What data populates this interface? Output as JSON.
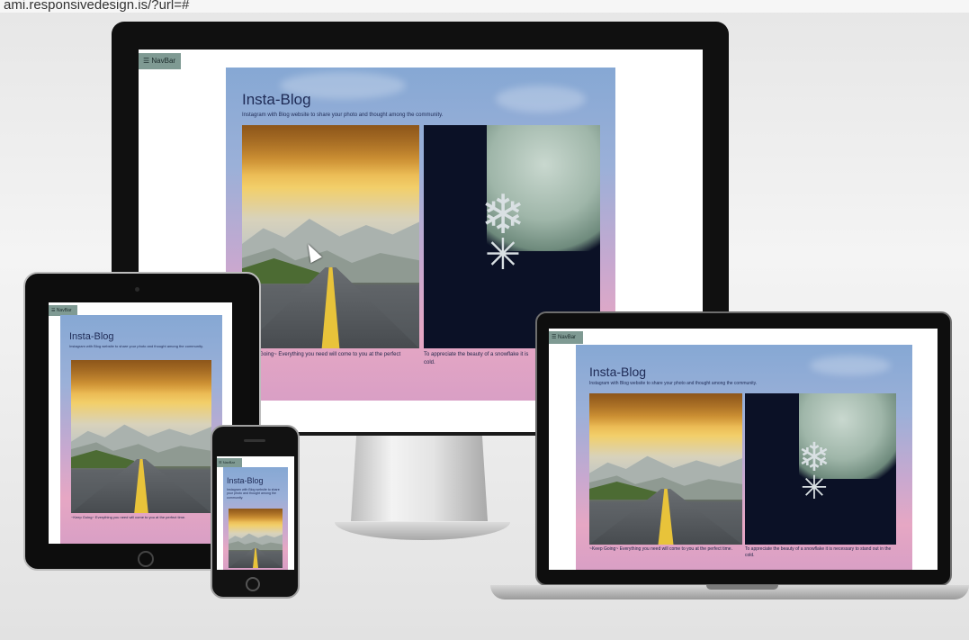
{
  "browser": {
    "url_text": "ami.responsivedesign.is/?url=#"
  },
  "site": {
    "nav_label": "☰ NavBar",
    "title": "Insta-Blog",
    "subtitle": "Instagram with Blog website to share your photo and thought among the community.",
    "posts": [
      {
        "image": "road-mountain-sunset-image",
        "caption": "~Keep Going~ Everything you need will come to you at the perfect time."
      },
      {
        "image": "snowflake-frost-image",
        "caption": "To appreciate the beauty of a snowflake it is necessary to stand out in the cold."
      }
    ]
  },
  "captions_visible": {
    "monitor_post1": "~Keep Going~ Everything you need will come to you at the perfect",
    "monitor_post2": "To appreciate the beauty of a snowflake it is",
    "monitor_post2_line2": "cold.",
    "tablet_post1": "~Keep Going~ Everything you need will come to you at the perfect time.",
    "phone_subtitle": "Instagram with Blog website to share your photo and thought among the community.",
    "laptop_post1": "~Keep Going~ Everything you need will come to you at the perfect time.",
    "laptop_post2": "To appreciate the beauty of a snowflake it is necessary to stand out in the cold."
  },
  "icons": {
    "cursor": "mouse-pointer-icon",
    "snowflake": "snowflake-icon",
    "menu": "hamburger-menu-icon"
  },
  "colors": {
    "title": "#1e2a55",
    "nav_button": "#7f9a93",
    "hero_top": "#86a8d4",
    "hero_bottom": "#e6a7c4"
  }
}
